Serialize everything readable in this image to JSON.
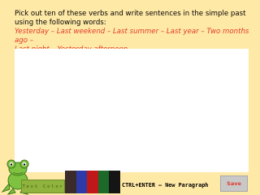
{
  "instructions": {
    "line1": "Pick out ten of these verbs and write sentences in the simple past",
    "line2": "using the following words:",
    "words_line1": "Yesterday – Last weekend – Last summer – Last year – Two months ago –",
    "words_line2": "Last night – Yesterday afternoon"
  },
  "writing_area": {
    "value": ""
  },
  "toolbar": {
    "text_color_label": "Text Color",
    "swatches": [
      "#3A2A2A",
      "#2E3AA8",
      "#C01818",
      "#1C6A2A",
      "#151515"
    ],
    "hint": "CTRL+ENTER – New Paragraph",
    "save_label": "Save"
  },
  "colors": {
    "background": "#FFE9A6",
    "instruction_words": "#E03A2A",
    "save_text": "#E03A2A"
  }
}
